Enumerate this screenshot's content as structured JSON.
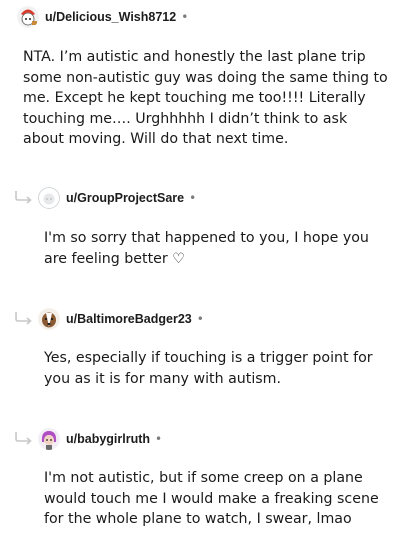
{
  "comments": [
    {
      "username": "u/Delicious_Wish8712",
      "separator": "•",
      "avatar_icon": "snoo-red-avatar-icon",
      "body": "NTA. I’m autistic and honestly the last plane trip some non-autistic guy was doing the same thing to me. Except he kept touching me too!!!! Literally touching me…. Urghhhhh I didn’t think to ask about moving. Will do that next time."
    },
    {
      "username": "u/GroupProjectSare",
      "separator": "•",
      "avatar_icon": "default-grey-avatar-icon",
      "body": "I'm so sorry that happened to you, I hope you are feeling better ♡"
    },
    {
      "username": "u/BaltimoreBadger23",
      "separator": "•",
      "avatar_icon": "badger-avatar-icon",
      "body": "Yes, especially if touching is a trigger point for you as it is for many with autism."
    },
    {
      "username": "u/babygirlruth",
      "separator": "•",
      "avatar_icon": "purple-hair-avatar-icon",
      "body": "I'm not autistic, but if some creep on a plane would touch me I would make a freaking scene for the whole plane to watch, I swear, lmao"
    }
  ],
  "colors": {
    "text": "#1a1a1b",
    "meta": "#7c7c7c",
    "reply_arrow": "#c8c8c8"
  }
}
